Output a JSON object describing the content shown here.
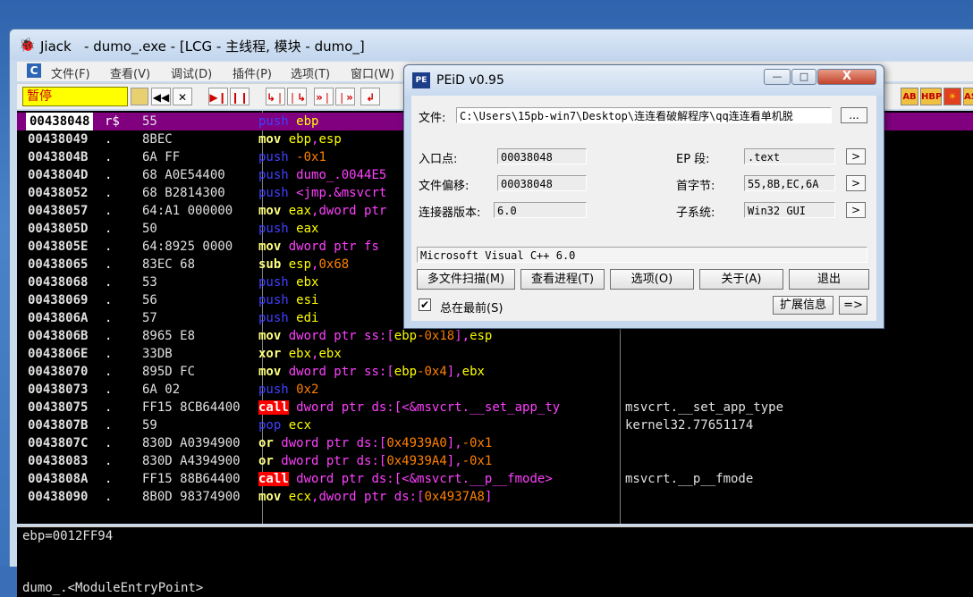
{
  "debugger": {
    "title": "Jiack   - dumo_.exe - [LCG - 主线程, 模块 - dumo_]",
    "menu": [
      "文件(F)",
      "查看(V)",
      "调试(D)",
      "插件(P)",
      "选项(T)",
      "窗口(W)"
    ],
    "status": "暂停",
    "toolbar_left": [
      "◀◀",
      "✕",
      "▶❙",
      "❙❙",
      "↳❘",
      "❘↳",
      "»❘",
      "❘»",
      "↲"
    ],
    "toolbar_right": [
      "AB",
      "HBP",
      "☀",
      "ASM"
    ],
    "rows": [
      {
        "addr": "00438048",
        "mark": "r$",
        "hex": "55",
        "op": "push",
        "args": "ebp",
        "comment": "",
        "selected": true
      },
      {
        "addr": "00438049",
        "mark": ".",
        "hex": "8BEC",
        "op": "mov",
        "args": "ebp,esp",
        "comment": ""
      },
      {
        "addr": "0043804B",
        "mark": ".",
        "hex": "6A FF",
        "op": "push",
        "args": "-0x1",
        "comment": ""
      },
      {
        "addr": "0043804D",
        "mark": ".",
        "hex": "68 A0E54400",
        "op": "push",
        "args": "dumo_.0044E5",
        "comment": ""
      },
      {
        "addr": "00438052",
        "mark": ".",
        "hex": "68 B2814300",
        "op": "push",
        "args": "<jmp.&msvcrt",
        "comment": ""
      },
      {
        "addr": "00438057",
        "mark": ".",
        "hex": "64:A1 000000",
        "op": "mov",
        "args": "eax,dword ptr",
        "comment": ""
      },
      {
        "addr": "0043805D",
        "mark": ".",
        "hex": "50",
        "op": "push",
        "args": "eax",
        "comment": ""
      },
      {
        "addr": "0043805E",
        "mark": ".",
        "hex": "64:8925 0000",
        "op": "mov",
        "args": "dword ptr fs",
        "comment": ""
      },
      {
        "addr": "00438065",
        "mark": ".",
        "hex": "83EC 68",
        "op": "sub",
        "args": "esp,0x68",
        "comment": ""
      },
      {
        "addr": "00438068",
        "mark": ".",
        "hex": "53",
        "op": "push",
        "args": "ebx",
        "comment": ""
      },
      {
        "addr": "00438069",
        "mark": ".",
        "hex": "56",
        "op": "push",
        "args": "esi",
        "comment": ""
      },
      {
        "addr": "0043806A",
        "mark": ".",
        "hex": "57",
        "op": "push",
        "args": "edi",
        "comment": ""
      },
      {
        "addr": "0043806B",
        "mark": ".",
        "hex": "8965 E8",
        "op": "mov",
        "args": "dword ptr ss:[ebp-0x18],esp",
        "comment": ""
      },
      {
        "addr": "0043806E",
        "mark": ".",
        "hex": "33DB",
        "op": "xor",
        "args": "ebx,ebx",
        "comment": ""
      },
      {
        "addr": "00438070",
        "mark": ".",
        "hex": "895D FC",
        "op": "mov",
        "args": "dword ptr ss:[ebp-0x4],ebx",
        "comment": ""
      },
      {
        "addr": "00438073",
        "mark": ".",
        "hex": "6A 02",
        "op": "push",
        "args": "0x2",
        "comment": ""
      },
      {
        "addr": "00438075",
        "mark": ".",
        "hex": "FF15 8CB64400",
        "op": "call",
        "args": "dword ptr ds:[<&msvcrt.__set_app_ty",
        "comment": "msvcrt.__set_app_type"
      },
      {
        "addr": "0043807B",
        "mark": ".",
        "hex": "59",
        "op": "pop",
        "args": "ecx",
        "comment": "kernel32.77651174"
      },
      {
        "addr": "0043807C",
        "mark": ".",
        "hex": "830D A0394900",
        "op": "or",
        "args": "dword ptr ds:[0x4939A0],-0x1",
        "comment": ""
      },
      {
        "addr": "00438083",
        "mark": ".",
        "hex": "830D A4394900",
        "op": "or",
        "args": "dword ptr ds:[0x4939A4],-0x1",
        "comment": ""
      },
      {
        "addr": "0043808A",
        "mark": ".",
        "hex": "FF15 88B64400",
        "op": "call",
        "args": "dword ptr ds:[<&msvcrt.__p__fmode>",
        "comment": "msvcrt.__p__fmode"
      },
      {
        "addr": "00438090",
        "mark": ".",
        "hex": "8B0D 98374900",
        "op": "mov",
        "args": "ecx,dword ptr ds:[0x4937A8]",
        "comment": ""
      }
    ],
    "info_line1": "ebp=0012FF94",
    "info_line2": "dumo_.<ModuleEntryPoint>"
  },
  "peid": {
    "title": "PEiD v0.95",
    "logo": "PE",
    "file_label": "文件:",
    "file_path": "C:\\Users\\15pb-win7\\Desktop\\连连看破解程序\\qq连连看单机脱",
    "browse_label": "...",
    "entry_label": "入口点:",
    "entry_value": "00038048",
    "ep_section_label": "EP 段:",
    "ep_section_value": ".text",
    "offset_label": "文件偏移:",
    "offset_value": "00038048",
    "first_bytes_label": "首字节:",
    "first_bytes_value": "55,8B,EC,6A",
    "linker_label": "连接器版本:",
    "linker_value": "6.0",
    "subsystem_label": "子系统:",
    "subsystem_value": "Win32 GUI",
    "result": "Microsoft Visual C++ 6.0",
    "btn_multi": "多文件扫描(M)",
    "btn_process": "查看进程(T)",
    "btn_options": "选项(O)",
    "btn_about": "关于(A)",
    "btn_exit": "退出",
    "ontop_label": "总在最前(S)",
    "ontop_checked": "✔",
    "btn_ext": "扩展信息",
    "btn_ext_arrow": "=>",
    "arrow": ">",
    "win_min": "—",
    "win_max": "□",
    "win_close": "X"
  }
}
